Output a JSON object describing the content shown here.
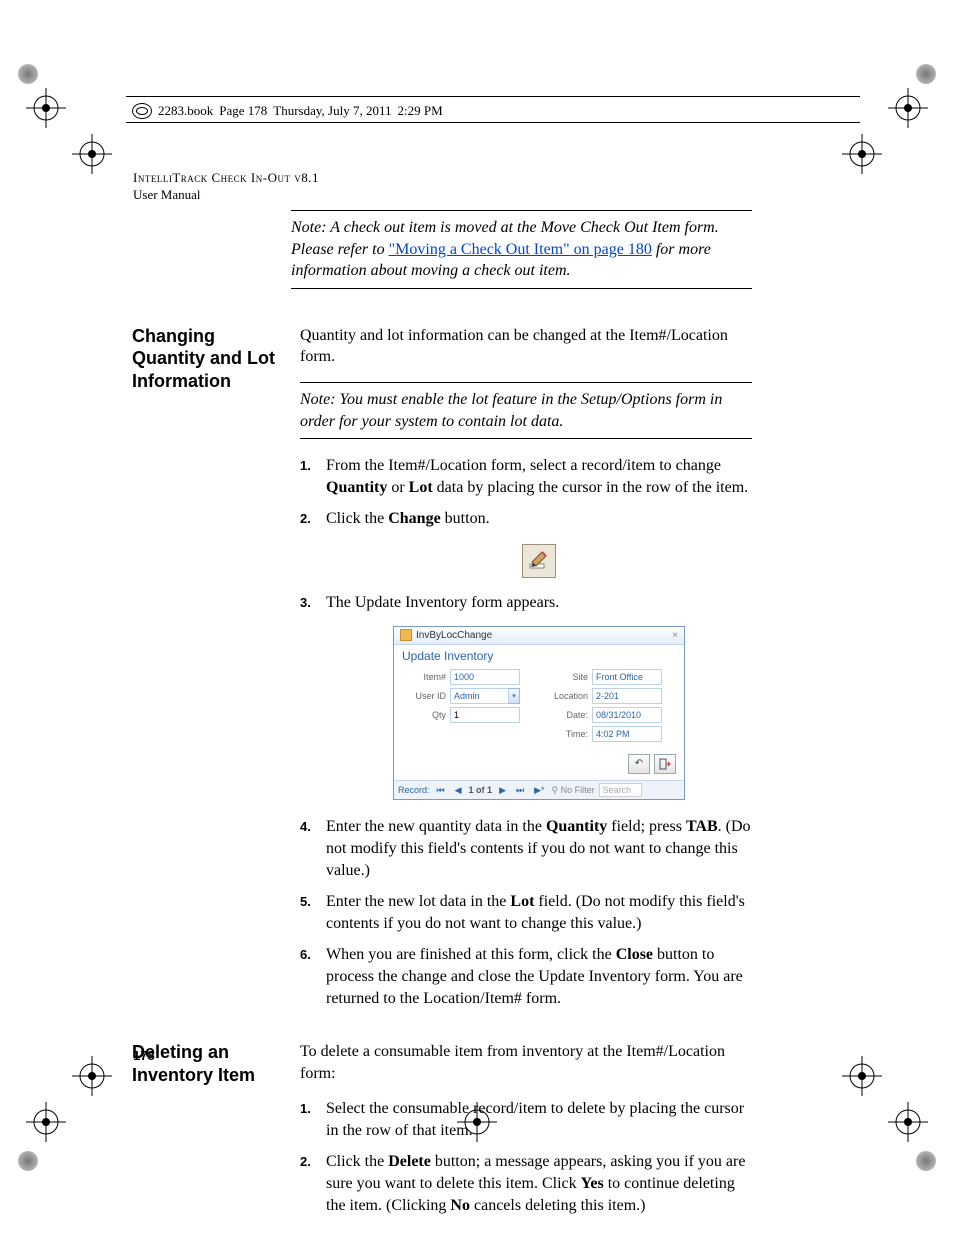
{
  "header": {
    "book": "2283.book",
    "page_line": "Page 178",
    "day": "Thursday, July 7, 2011",
    "time": "2:29 PM"
  },
  "running": {
    "title": "IntelliTrack Check In-Out v8.1",
    "subtitle": "User Manual"
  },
  "note1": {
    "label": "Note:",
    "before": "A check out item is moved at the Move Check Out Item form. Please refer to ",
    "link": "\"Moving a Check Out Item\" on page 180",
    "after": " for more information about moving a check out item."
  },
  "sectionA": {
    "heading": "Changing Quantity and Lot Information",
    "intro": "Quantity and lot information can be changed at the Item#/Location form.",
    "note": {
      "label": "Note:",
      "text": "You must enable the lot feature in the Setup/Options form in order for your system to contain lot data."
    },
    "steps": {
      "s1a": "From the Item#/Location form, select a record/item to change ",
      "s1b": "Quantity",
      "s1c": " or ",
      "s1d": "Lot",
      "s1e": " data by placing the cursor in the row of the item.",
      "s2a": "Click the ",
      "s2b": "Change",
      "s2c": " button.",
      "s3": "The Update Inventory form appears.",
      "s4a": "Enter the new quantity data in the ",
      "s4b": "Quantity",
      "s4c": " field; press ",
      "s4d": "TAB",
      "s4e": ". (Do not modify this field's contents if you do not want to change this value.)",
      "s5a": "Enter the new lot data in the ",
      "s5b": "Lot",
      "s5c": " field. (Do not modify this field's contents if you do not want to change this value.)",
      "s6a": "When you are finished at this form, click the ",
      "s6b": "Close",
      "s6c": " button to process the change and close the Update Inventory form. You are returned to the Location/Item# form."
    }
  },
  "form": {
    "window_title": "InvByLocChange",
    "header": "Update Inventory",
    "labels": {
      "item": "Item#",
      "userid": "User ID",
      "qty": "Qty",
      "site": "Site",
      "location": "Location",
      "date": "Date:",
      "time": "Time:"
    },
    "values": {
      "item": "1000",
      "userid": "Admin",
      "qty": "1",
      "site": "Front Office",
      "location": "2-201",
      "date": "08/31/2010",
      "time": "4:02 PM"
    },
    "nav": {
      "label": "Record:",
      "pos": "1 of 1",
      "nofilter": "No Filter",
      "search": "Search"
    }
  },
  "sectionB": {
    "heading": "Deleting an Inventory Item",
    "intro": "To delete a consumable item from inventory at the Item#/Location form:",
    "s1": "Select the consumable record/item to delete by placing the cursor in the row of that item.",
    "s2a": "Click the ",
    "s2b": "Delete",
    "s2c": " button; a message appears, asking you if you are sure you want to delete this item. Click ",
    "s2d": "Yes",
    "s2e": " to continue deleting the item. (Clicking ",
    "s2f": "No",
    "s2g": " cancels deleting this item.)"
  },
  "page_number": "178"
}
